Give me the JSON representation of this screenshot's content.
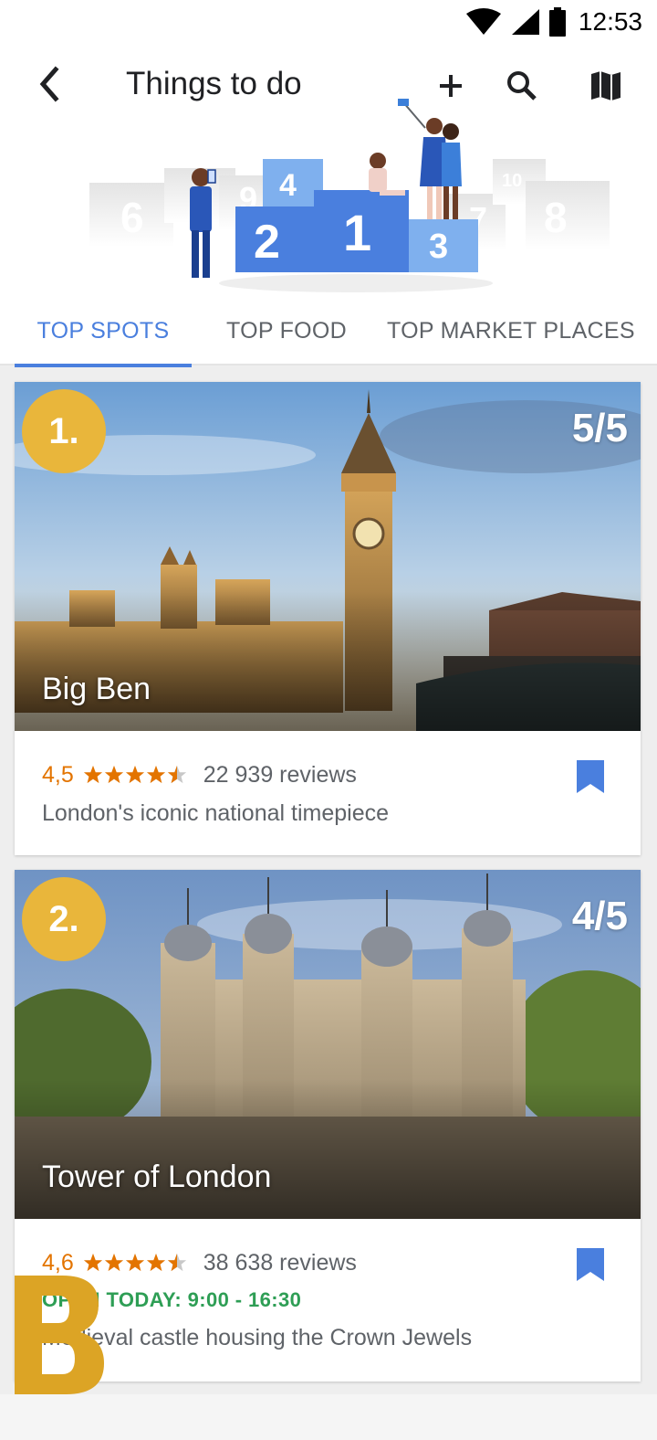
{
  "status_bar": {
    "time": "12:53"
  },
  "header": {
    "title": "Things to do"
  },
  "illustration": {
    "podium_numbers": [
      "6",
      "9",
      "4",
      "2",
      "1",
      "3",
      "7",
      "8",
      "10"
    ]
  },
  "tabs": [
    {
      "label": "TOP SPOTS",
      "active": true
    },
    {
      "label": "TOP FOOD",
      "active": false
    },
    {
      "label": "TOP MARKET PLACES",
      "active": false
    }
  ],
  "cards": [
    {
      "rank": "1.",
      "score": "5/5",
      "name": "Big Ben",
      "rating": "4,5",
      "stars": 4.5,
      "reviews": "22 939 reviews",
      "open_hours": "",
      "description": "London's iconic national timepiece"
    },
    {
      "rank": "2.",
      "score": "4/5",
      "name": "Tower of London",
      "rating": "4,6",
      "stars": 4.5,
      "reviews": "38 638 reviews",
      "open_hours": "OPEN TODAY: 9:00 - 16:30",
      "description": "Medieval castle housing the Crown Jewels"
    }
  ],
  "overlay_logo": {
    "letter": "B",
    "color": "#dca425"
  },
  "colors": {
    "accent": "#4a7fde",
    "rating": "#e37400",
    "badge": "#e9b63b",
    "open": "#2e9e55",
    "bookmark": "#4a7fde"
  },
  "icons": [
    "back-arrow-icon",
    "add-icon",
    "search-icon",
    "map-icon",
    "star-icon",
    "bookmark-icon",
    "wifi-icon",
    "signal-icon",
    "battery-icon"
  ]
}
